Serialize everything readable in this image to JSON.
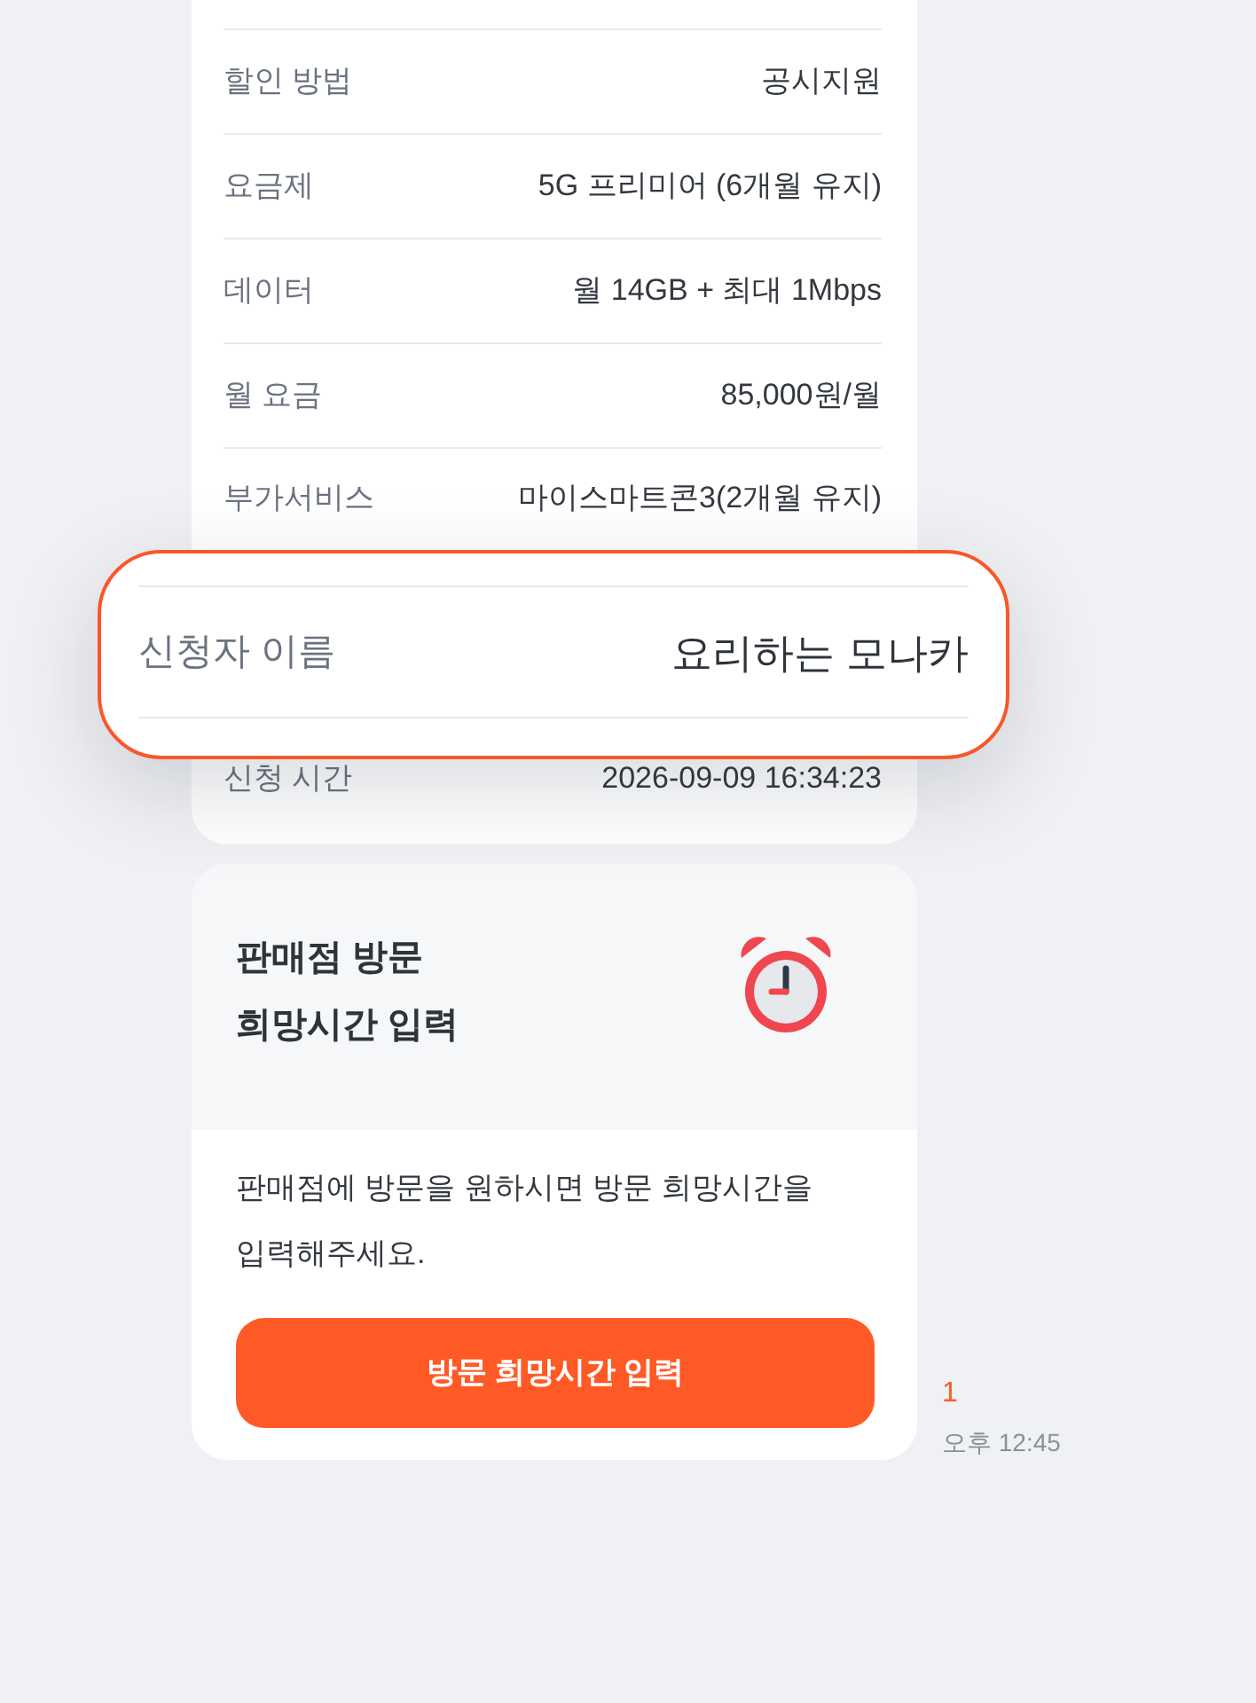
{
  "details": {
    "rows": [
      {
        "label": "할인 방법",
        "value": "공시지원"
      },
      {
        "label": "요금제",
        "value": "5G 프리미어 (6개월 유지)"
      },
      {
        "label": "데이터",
        "value": "월 14GB + 최대 1Mbps"
      },
      {
        "label": "월 요금",
        "value": "85,000원/월"
      },
      {
        "label": "부가서비스",
        "value": "마이스마트콘3(2개월 유지)"
      }
    ],
    "highlight": {
      "label": "신청자 이름",
      "value": "요리하는 모나카"
    },
    "rows_below": [
      {
        "label": "신청 시간",
        "value": "2026-09-09 16:34:23"
      }
    ]
  },
  "visit_card": {
    "title": "판매점 방문\n희망시간 입력",
    "description": "판매점에 방문을 원하시면 방문 희망시간을 입력해주세요.",
    "button": "방문 희망시간 입력"
  },
  "message_meta": {
    "unread_count": "1",
    "time": "오후 12:45"
  }
}
